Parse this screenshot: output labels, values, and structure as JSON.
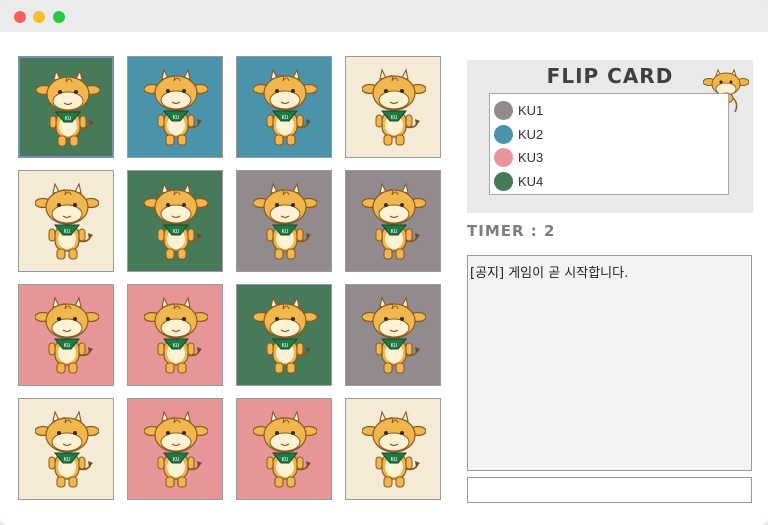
{
  "titlebar": {
    "buttons": [
      "close",
      "minimize",
      "zoom"
    ]
  },
  "board": {
    "cards": [
      {
        "color": "#477a58",
        "selected": true
      },
      {
        "color": "#4b92ab",
        "selected": false
      },
      {
        "color": "#4b92ab",
        "selected": false
      },
      {
        "color": "#f5ead6",
        "selected": false
      },
      {
        "color": "#f5ead6",
        "selected": false
      },
      {
        "color": "#477a58",
        "selected": false
      },
      {
        "color": "#938a8e",
        "selected": false
      },
      {
        "color": "#938a8e",
        "selected": false
      },
      {
        "color": "#e89598",
        "selected": false
      },
      {
        "color": "#e89598",
        "selected": false
      },
      {
        "color": "#477a58",
        "selected": false
      },
      {
        "color": "#938a8e",
        "selected": false
      },
      {
        "color": "#f5ead6",
        "selected": false
      },
      {
        "color": "#e89598",
        "selected": false
      },
      {
        "color": "#e89598",
        "selected": false
      },
      {
        "color": "#f5ead6",
        "selected": false
      }
    ]
  },
  "panel": {
    "title": "FLIP CARD",
    "legend": [
      {
        "label": "KU1",
        "color": "#938a8e"
      },
      {
        "label": "KU2",
        "color": "#4b92ab"
      },
      {
        "label": "KU3",
        "color": "#e89598"
      },
      {
        "label": "KU4",
        "color": "#477a58"
      }
    ]
  },
  "timer": {
    "text": "TIMER : 2"
  },
  "chat": {
    "messages": [
      "[공지] 게임이 곧 시작합니다."
    ],
    "input_value": ""
  }
}
